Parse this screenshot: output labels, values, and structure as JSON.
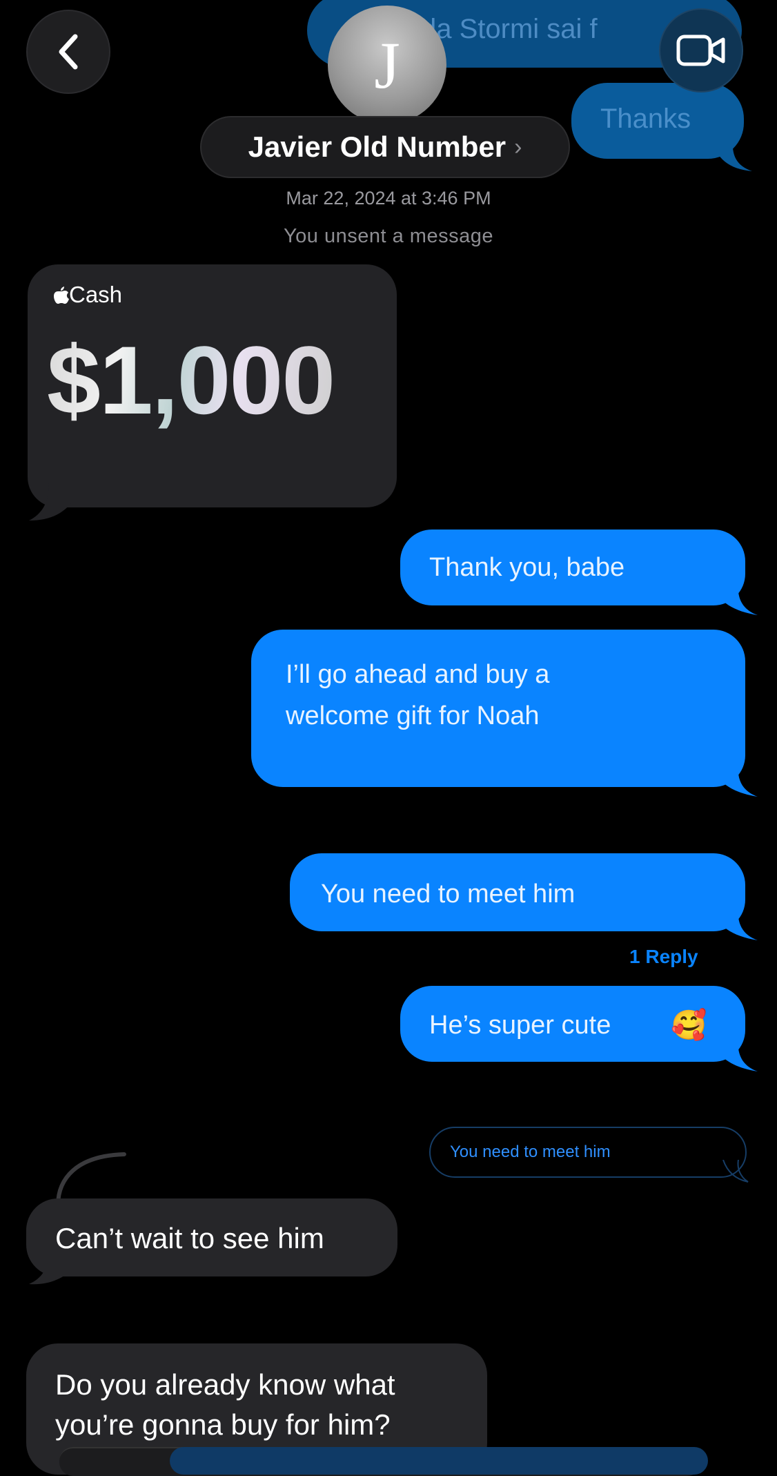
{
  "header": {
    "faded_message_text": "da Stormi sai f",
    "faded_thanks_text": "Thanks",
    "avatar_initial": "J",
    "contact_name": "Javier Old Number",
    "contact_chevron": "›",
    "timestamp": "Mar 22, 2024 at 3:46 PM",
    "unsent_notice": "You unsent a message"
  },
  "cash": {
    "label": "Cash",
    "amount": "$1,000"
  },
  "messages": {
    "out_1": "Thank you, babe",
    "out_2_line1": "I’ll go ahead and buy a",
    "out_2_line2": "welcome gift for Noah",
    "out_3": "You need to meet him",
    "reply_count": "1 Reply",
    "out_4": "He’s super cute",
    "out_4_emoji": "🥰",
    "quoted_reply": "You need to meet him",
    "in_1": "Can’t wait to see him",
    "in_2_line1": "Do you already know what",
    "in_2_line2": "you’re gonna buy for him?"
  },
  "colors": {
    "outgoing_bubble": "#0a84ff",
    "incoming_bubble": "#262629",
    "background": "#000000"
  },
  "icons": {
    "back": "chevron-left-icon",
    "video": "video-camera-icon",
    "apple": "apple-logo-icon"
  }
}
